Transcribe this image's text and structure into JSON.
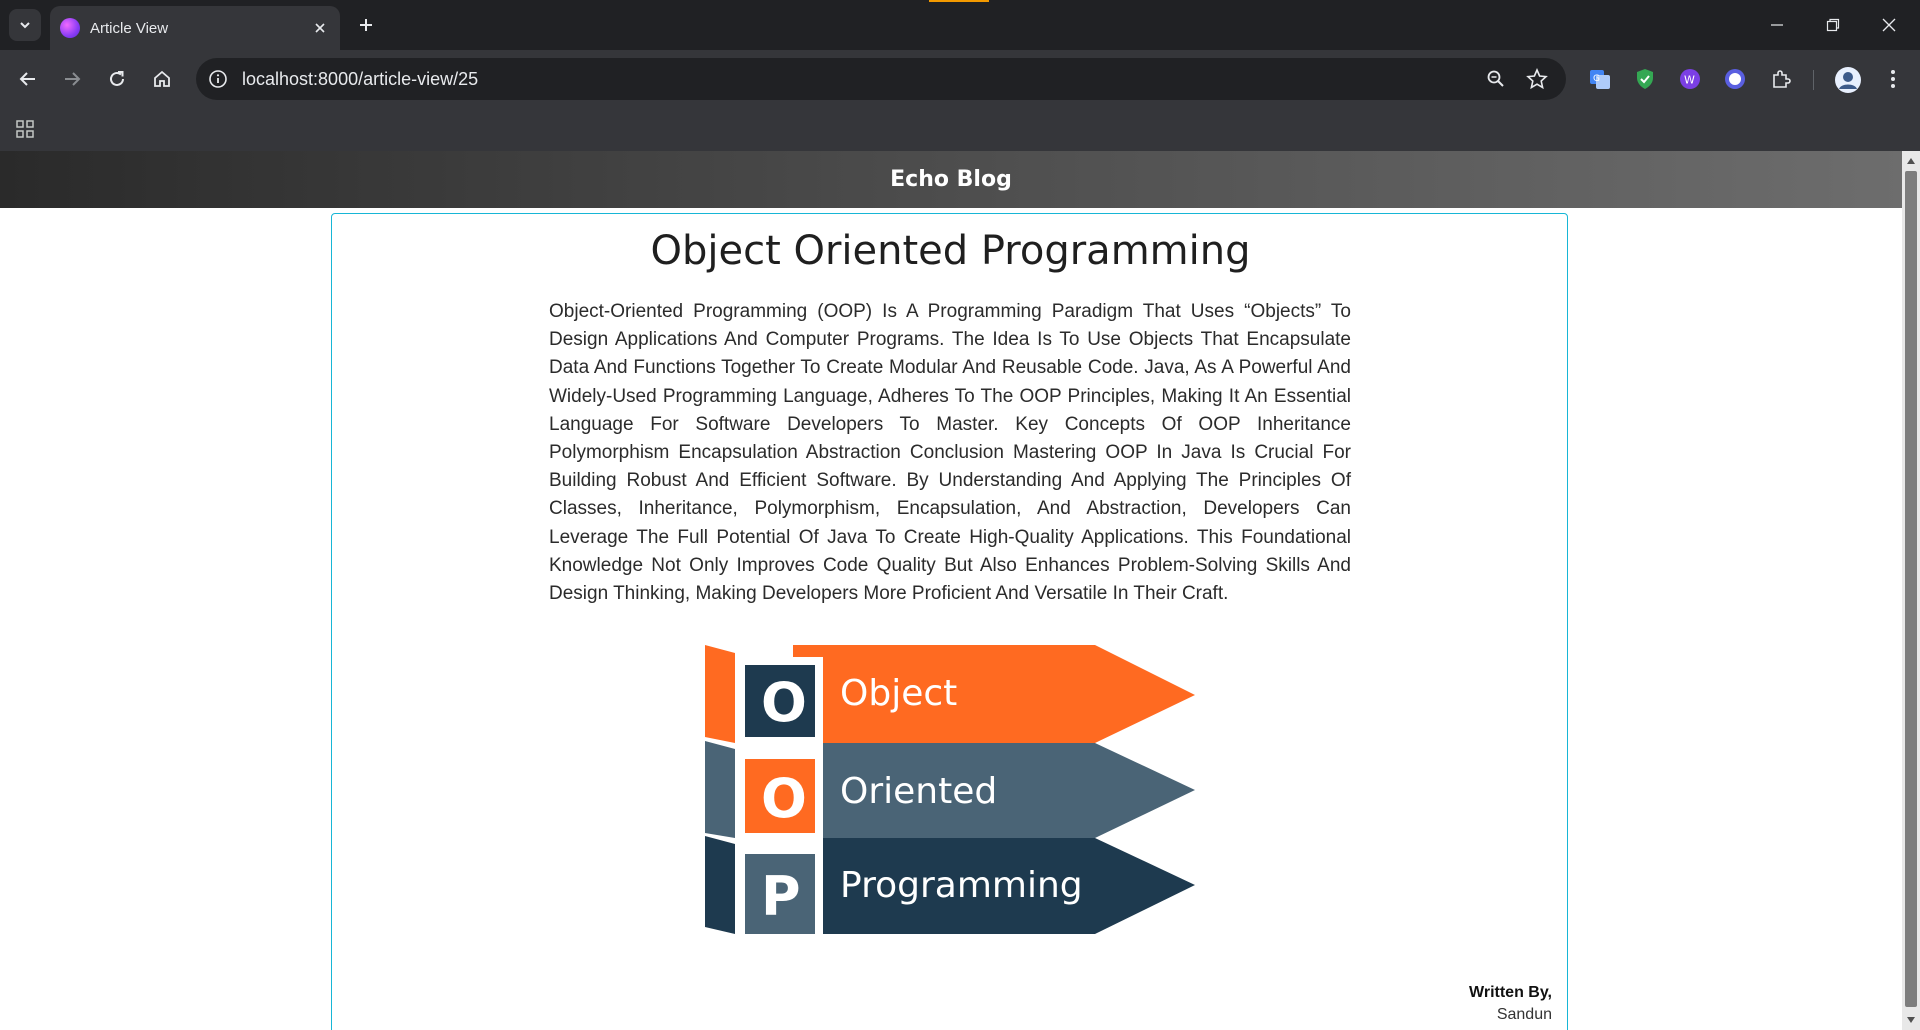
{
  "browser": {
    "tab_title": "Article View",
    "url": "localhost:8000/article-view/25",
    "icons": {
      "tab_list": "chevron-down-icon",
      "close_tab": "close-icon",
      "new_tab": "plus-icon",
      "back": "arrow-left-icon",
      "forward": "arrow-right-icon",
      "reload": "reload-icon",
      "home": "home-icon",
      "site_info": "info-icon",
      "zoom": "zoom-icon",
      "bookmark": "star-icon",
      "apps": "apps-grid-icon",
      "extensions": [
        "translate-icon",
        "shield-icon",
        "w-extension-icon",
        "circle-extension-icon",
        "puzzle-icon"
      ],
      "profile": "avatar-icon",
      "menu": "kebab-menu-icon"
    }
  },
  "site": {
    "title": "Echo Blog"
  },
  "article": {
    "title": "Object Oriented Programming",
    "body": "Object-Oriented Programming (OOP) Is A Programming Paradigm That Uses “Objects” To Design Applications And Computer Programs. The Idea Is To Use Objects That Encapsulate Data And Functions Together To Create Modular And Reusable Code. Java, As A Powerful And Widely-Used Programming Language, Adheres To The OOP Principles, Making It An Essential Language For Software Developers To Master. Key Concepts Of OOP Inheritance Polymorphism Encapsulation Abstraction Conclusion Mastering OOP In Java Is Crucial For Building Robust And Efficient Software. By Understanding And Applying The Principles Of Classes, Inheritance, Polymorphism, Encapsulation, And Abstraction, Developers Can Leverage The Full Potential Of Java To Create High-Quality Applications. This Foundational Knowledge Not Only Improves Code Quality But Also Enhances Problem-Solving Skills And Design Thinking, Making Developers More Proficient And Versatile In Their Craft.",
    "image": {
      "rows": [
        {
          "letter": "O",
          "label": "Object"
        },
        {
          "letter": "O",
          "label": "Oriented"
        },
        {
          "letter": "P",
          "label": "Programming"
        }
      ]
    },
    "written_by_label": "Written By,",
    "author": "Sandun"
  },
  "colors": {
    "orange": "#ff6a21",
    "slate": "#4a6476",
    "navy": "#1e3a4f",
    "card_border": "#17b6d6"
  }
}
